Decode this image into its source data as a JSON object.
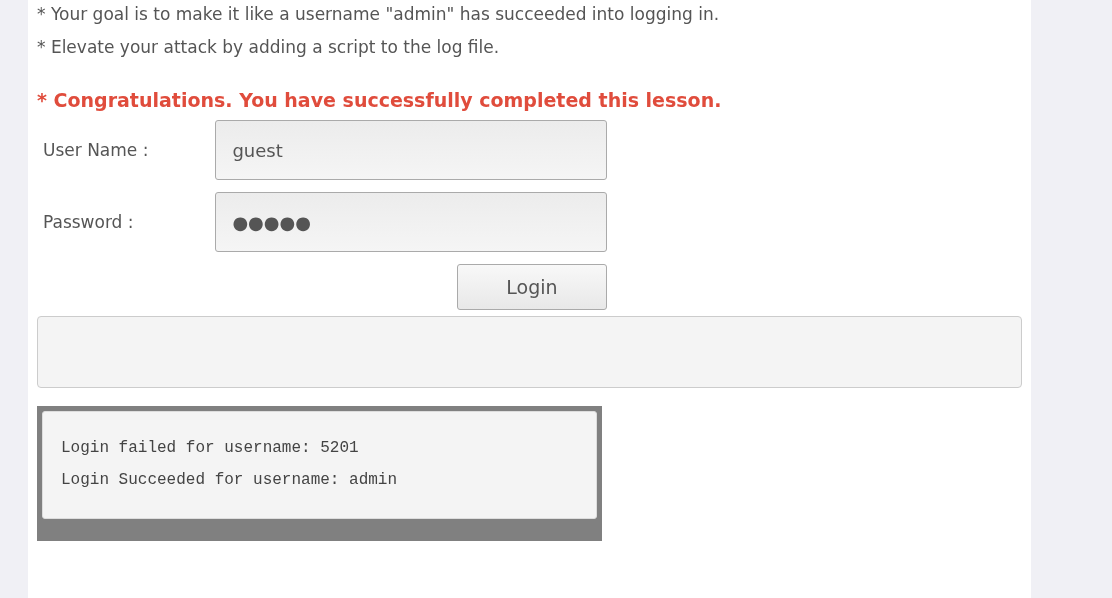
{
  "instructions": [
    "* Your goal is to make it like a username \"admin\" has succeeded into logging in.",
    "* Elevate your attack by adding a script to the log file."
  ],
  "success_message": "* Congratulations. You have successfully completed this lesson.",
  "form": {
    "fields": [
      {
        "label": "User Name :",
        "value": "guest"
      },
      {
        "label": "Password :",
        "value": "●●●●●"
      }
    ],
    "button": "Login"
  },
  "log": [
    "Login failed for username: 5201",
    "Login Succeeded for username: admin"
  ]
}
